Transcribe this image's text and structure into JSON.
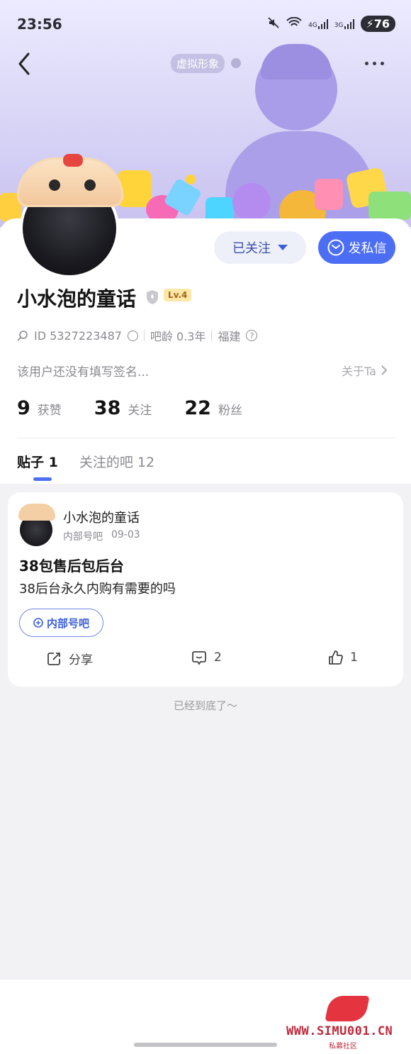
{
  "status_bar": {
    "time": "23:56",
    "net_1": "4G",
    "net_2": "3G",
    "battery": "76"
  },
  "header": {
    "avatar_tag": "虚拟形象"
  },
  "profile": {
    "follow_button": "已关注",
    "message_button": "发私信",
    "name": "小水泡的童话",
    "level": "Lv.4",
    "id": "ID 5327223487",
    "bar_age": "吧龄 0.3年",
    "location": "福建",
    "signature": "该用户还没有填写签名...",
    "about": "关于Ta",
    "stats": [
      {
        "num": "9",
        "label": "获赞"
      },
      {
        "num": "38",
        "label": "关注"
      },
      {
        "num": "22",
        "label": "粉丝"
      }
    ]
  },
  "tabs": [
    {
      "label": "贴子 1",
      "active": true
    },
    {
      "label": "关注的吧 12",
      "active": false
    }
  ],
  "post": {
    "author": "小水泡的童话",
    "forum": "内部号吧",
    "date": "09-03",
    "title": "38包售后包后台",
    "body": "38后台永久内购有需要的吗",
    "tag": "内部号吧",
    "share": "分享",
    "comments": "2",
    "likes": "1"
  },
  "end_text": "已经到底了～",
  "watermark": {
    "site": "WWW.SIMU001.CN",
    "sub": "私募社区"
  },
  "colors": {
    "accent": "#4c6ef5",
    "banner_top": "#ecebff",
    "banner_bottom": "#c9c2f0",
    "level_bg": "#fde8a8"
  }
}
